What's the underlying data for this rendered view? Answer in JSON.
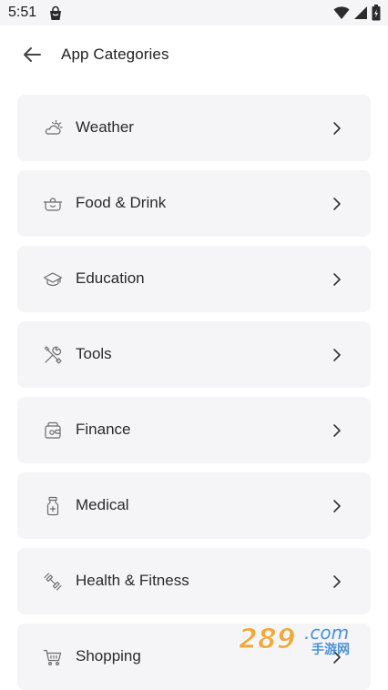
{
  "status_bar": {
    "time": "5:51",
    "app_icon": "shopping-bag-icon",
    "indicators": [
      "wifi-icon",
      "signal-icon",
      "battery-icon"
    ]
  },
  "header": {
    "back_icon": "arrow-left-icon",
    "title": "App Categories"
  },
  "categories": [
    {
      "label": "Weather",
      "icon": "cloud-sun-icon"
    },
    {
      "label": "Food & Drink",
      "icon": "cooking-pot-icon"
    },
    {
      "label": "Education",
      "icon": "graduation-cap-icon"
    },
    {
      "label": "Tools",
      "icon": "wrench-screwdriver-icon"
    },
    {
      "label": "Finance",
      "icon": "wallet-icon"
    },
    {
      "label": "Medical",
      "icon": "medicine-bottle-icon"
    },
    {
      "label": "Health & Fitness",
      "icon": "dumbbell-icon"
    },
    {
      "label": "Shopping",
      "icon": "shopping-cart-icon"
    }
  ],
  "watermark": {
    "text": "289.com",
    "subtext": "手游网"
  },
  "colors": {
    "card_background": "#f5f5f7",
    "text": "#222222",
    "icon": "#6b6b6b",
    "watermark_orange": "#f29b1d",
    "watermark_blue": "#2f7fd0"
  }
}
